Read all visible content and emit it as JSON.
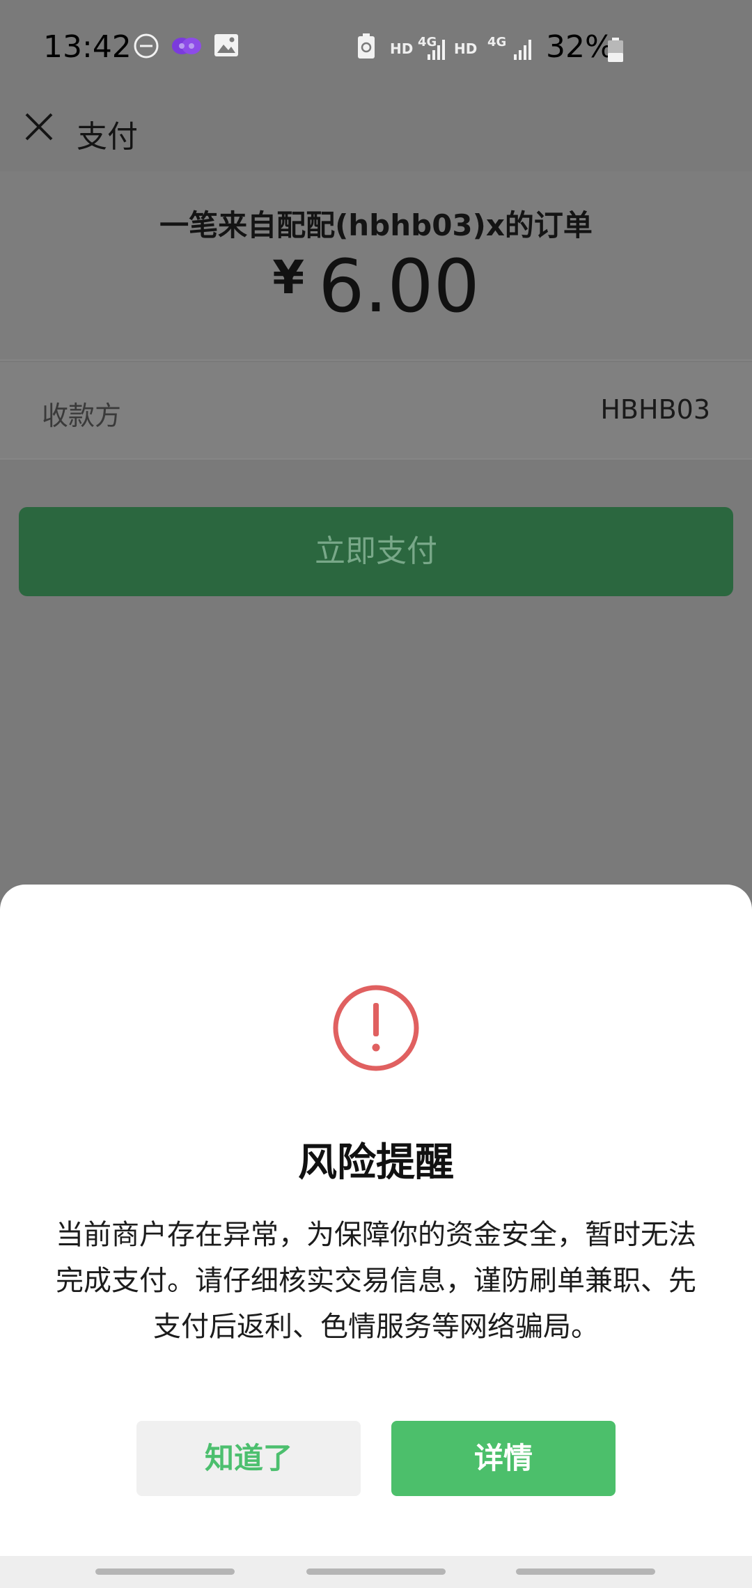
{
  "status_bar": {
    "time": "13:42",
    "battery_percent": "32%",
    "net1": "HD",
    "net2": "4G",
    "net3": "HD",
    "net4": "4G",
    "icons": [
      "do-not-disturb-icon",
      "app-notification-icon",
      "image-icon",
      "recycle-icon",
      "signal-icon",
      "battery-icon"
    ]
  },
  "header": {
    "title": "支付"
  },
  "order": {
    "title": "一笔来自配配(hbhb03)x的订单",
    "currency_symbol": "¥",
    "amount": "6.00"
  },
  "payee": {
    "label": "收款方",
    "value": "HBHB03"
  },
  "pay_button": {
    "label": "立即支付"
  },
  "risk_sheet": {
    "title": "风险提醒",
    "message": "当前商户存在异常，为保障你的资金安全，暂时无法完成支付。请仔细核实交易信息，谨防刷单兼职、先支付后返利、色情服务等网络骗局。",
    "ok_label": "知道了",
    "detail_label": "详情"
  },
  "colors": {
    "overlay": "#7a7a7a",
    "pay_button_dim": "#2b673f",
    "accent_green": "#4cbf6b",
    "warning_red": "#e06060"
  }
}
